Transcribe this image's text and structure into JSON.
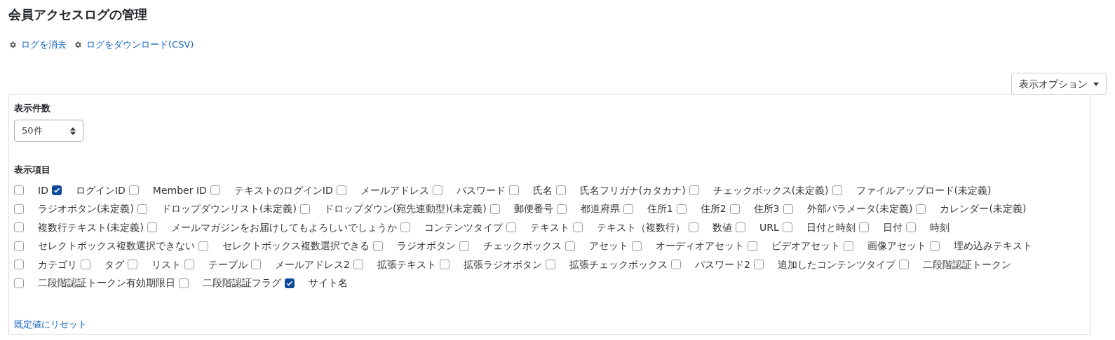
{
  "title": "会員アクセスログの管理",
  "actions": [
    {
      "label": "ログを消去"
    },
    {
      "label": "ログをダウンロード(CSV)"
    }
  ],
  "options_button": {
    "label": "表示オプション"
  },
  "page_size": {
    "label": "表示件数",
    "value": "50件"
  },
  "fields": {
    "label": "表示項目",
    "items": [
      {
        "label": "ID",
        "checked": false
      },
      {
        "label": "ログインID",
        "checked": true
      },
      {
        "label": "Member ID",
        "checked": false
      },
      {
        "label": "テキストのログインID",
        "checked": false
      },
      {
        "label": "メールアドレス",
        "checked": false
      },
      {
        "label": "パスワード",
        "checked": false
      },
      {
        "label": "氏名",
        "checked": false
      },
      {
        "label": "氏名フリガナ(カタカナ)",
        "checked": false
      },
      {
        "label": "チェックボックス(未定義)",
        "checked": false
      },
      {
        "label": "ファイルアップロード(未定義)",
        "checked": false
      },
      {
        "label": "ラジオボタン(未定義)",
        "checked": false
      },
      {
        "label": "ドロップダウンリスト(未定義)",
        "checked": false
      },
      {
        "label": "ドロップダウン(宛先連動型)(未定義)",
        "checked": false
      },
      {
        "label": "郵便番号",
        "checked": false
      },
      {
        "label": "都道府県",
        "checked": false
      },
      {
        "label": "住所1",
        "checked": false
      },
      {
        "label": "住所2",
        "checked": false
      },
      {
        "label": "住所3",
        "checked": false
      },
      {
        "label": "外部パラメータ(未定義)",
        "checked": false
      },
      {
        "label": "カレンダー(未定義)",
        "checked": false
      },
      {
        "label": "複数行テキスト(未定義)",
        "checked": false
      },
      {
        "label": "メールマガジンをお届けしてもよろしいでしょうか",
        "checked": false
      },
      {
        "label": "コンテンツタイプ",
        "checked": false
      },
      {
        "label": "テキスト",
        "checked": false
      },
      {
        "label": "テキスト（複数行）",
        "checked": false
      },
      {
        "label": "数値",
        "checked": false
      },
      {
        "label": "URL",
        "checked": false
      },
      {
        "label": "日付と時刻",
        "checked": false
      },
      {
        "label": "日付",
        "checked": false
      },
      {
        "label": "時刻",
        "checked": false
      },
      {
        "label": "セレクトボックス複数選択できない",
        "checked": false
      },
      {
        "label": "セレクトボックス複数選択できる",
        "checked": false
      },
      {
        "label": "ラジオボタン",
        "checked": false
      },
      {
        "label": "チェックボックス",
        "checked": false
      },
      {
        "label": "アセット",
        "checked": false
      },
      {
        "label": "オーディオアセット",
        "checked": false
      },
      {
        "label": "ビデオアセット",
        "checked": false
      },
      {
        "label": "画像アセット",
        "checked": false
      },
      {
        "label": "埋め込みテキスト",
        "checked": false
      },
      {
        "label": "カテゴリ",
        "checked": false
      },
      {
        "label": "タグ",
        "checked": false
      },
      {
        "label": "リスト",
        "checked": false
      },
      {
        "label": "テーブル",
        "checked": false
      },
      {
        "label": "メールアドレス2",
        "checked": false
      },
      {
        "label": "拡張テキスト",
        "checked": false
      },
      {
        "label": "拡張ラジオボタン",
        "checked": false
      },
      {
        "label": "拡張チェックボックス",
        "checked": false
      },
      {
        "label": "パスワード2",
        "checked": false
      },
      {
        "label": "追加したコンテンツタイプ",
        "checked": false
      },
      {
        "label": "二段階認証トークン",
        "checked": false
      },
      {
        "label": "二段階認証トークン有効期限日",
        "checked": false
      },
      {
        "label": "二段階認証フラグ",
        "checked": false
      },
      {
        "label": "サイト名",
        "checked": true
      }
    ]
  },
  "reset_link": {
    "label": "既定値にリセット"
  }
}
